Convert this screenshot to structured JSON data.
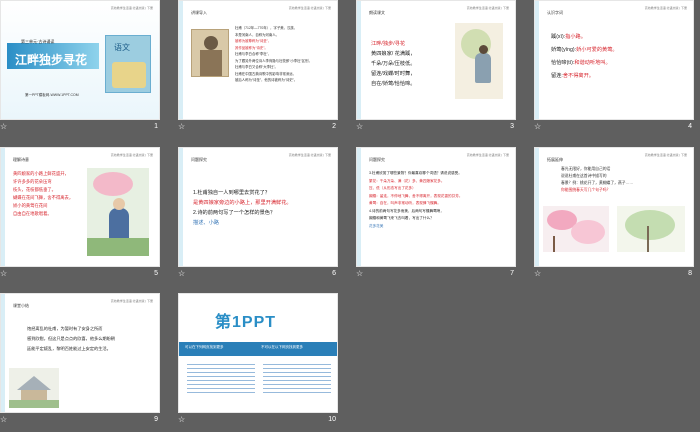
{
  "header_text": "高効教学生活语 北语文版 | 下册",
  "slides": [
    {
      "n": "1",
      "unit": "第三单元·古诗诵读",
      "title": "江畔独步寻花",
      "site": "第一PPT模板网-WWW.1PPT.COM",
      "book": "语文"
    },
    {
      "n": "2",
      "tag": "讲课导入",
      "lines": [
        "杜甫（712年—770年），字子美，汉族，",
        "本是河南人，自称为河南人。",
        "被称为被尊称为“诗圣”，",
        "其作品被称为“诗史”。",
        "杜甫与李白合称“李杜”，",
        "为了跟另外两位诗人李商隐与杜牧即“小李杜”区别，",
        "杜甫与李白又合称“大李杜”。",
        "杜甫在中国古典诗歌中的影响非常深远，",
        "被后人称为“诗圣”，他的诗被称为“诗史”。"
      ]
    },
    {
      "n": "3",
      "tag": "朗读课文",
      "poem": [
        "江畔/独步/寻花",
        "黄四娘家/ 花满蹊，",
        "千朵/万朵/压枝低。",
        "留连/戏蝶/时时舞，",
        "自在/娇莺/恰恰啼。"
      ]
    },
    {
      "n": "4",
      "tag": "认识字词",
      "words": [
        {
          "a": "蹊(xī):",
          "b": "指小路。"
        },
        {
          "a": "娇莺(yīng):",
          "b": "娇小可爱的黄莺。"
        },
        {
          "a": "恰恰啼(tí):",
          "b": "和谐动听地叫。"
        },
        {
          "a": "留连:",
          "b": "舍不得离开。"
        }
      ]
    },
    {
      "n": "5",
      "tag": "理解诗意",
      "lines": [
        "黄四娘家的小路上鲜花盛开，",
        "许许多多的花朵压弯",
        "枝头，花枝都低垂了。",
        "蝴蝶在花间飞舞，舍不得离去，",
        "娇小的黄莺在花间",
        "自由自在地歌唱着。"
      ]
    },
    {
      "n": "6",
      "tag": "问题探究",
      "qa": [
        {
          "q": "1.杜甫独自一人到哪里去赏花了？",
          "a": "是黄四娘家旁边的小路上，那里开满鲜花。"
        },
        {
          "q": "2.诗的前两句写了一个怎样的景色？",
          "a": "描述、小路"
        }
      ]
    },
    {
      "n": "7",
      "tag": "问题探究",
      "lines": [
        "3.杜甫欣赏了哪些景物？你最喜欢哪个词语？请说说感受。",
        "繁花：千朵万朵、满（花）多、黄四娘家花多。",
        "压、低（从形态写出了花多）",
        "蝴蝶：留连，不停地飞舞，舍不得离开，表现花香的芬芳。",
        "黄莺：自在，叫声非常动听，表现蜂飞蝶舞。",
        "4.诗的前两句写花多而美，后两句写蝶舞莺啼，",
        "蝴蝶和黄莺飞来飞去叫着，写出了什么？",
        "花多花美"
      ]
    },
    {
      "n": "8",
      "tag": "拓展延伸",
      "lines": [
        "春光无限好，你能用自己的话",
        "说说杜甫在这首诗中描写的",
        "春景？例：桃花开了，黄蝴蝶了，燕子……",
        "你能围绕春天写几个句子吗？"
      ]
    },
    {
      "n": "9",
      "tag": "课堂小结",
      "lines": [
        "饱经离乱的杜甫，为暂时有了安身之所而",
        "感到欣慰，但这只是点点的欣喜，他多么期盼朝",
        "廷能平定叛乱，黎明百姓能过上安定的生活。"
      ]
    },
    {
      "n": "10",
      "logo": "第1PPT",
      "left_head": "可以在下列网页找到更多",
      "right_head": "不可以在以下网页找到更多"
    }
  ],
  "colors": {
    "accent": "#2c8fc4",
    "red": "#d7262e",
    "blue": "#3a78b8",
    "bg": "#5f5f5f"
  }
}
